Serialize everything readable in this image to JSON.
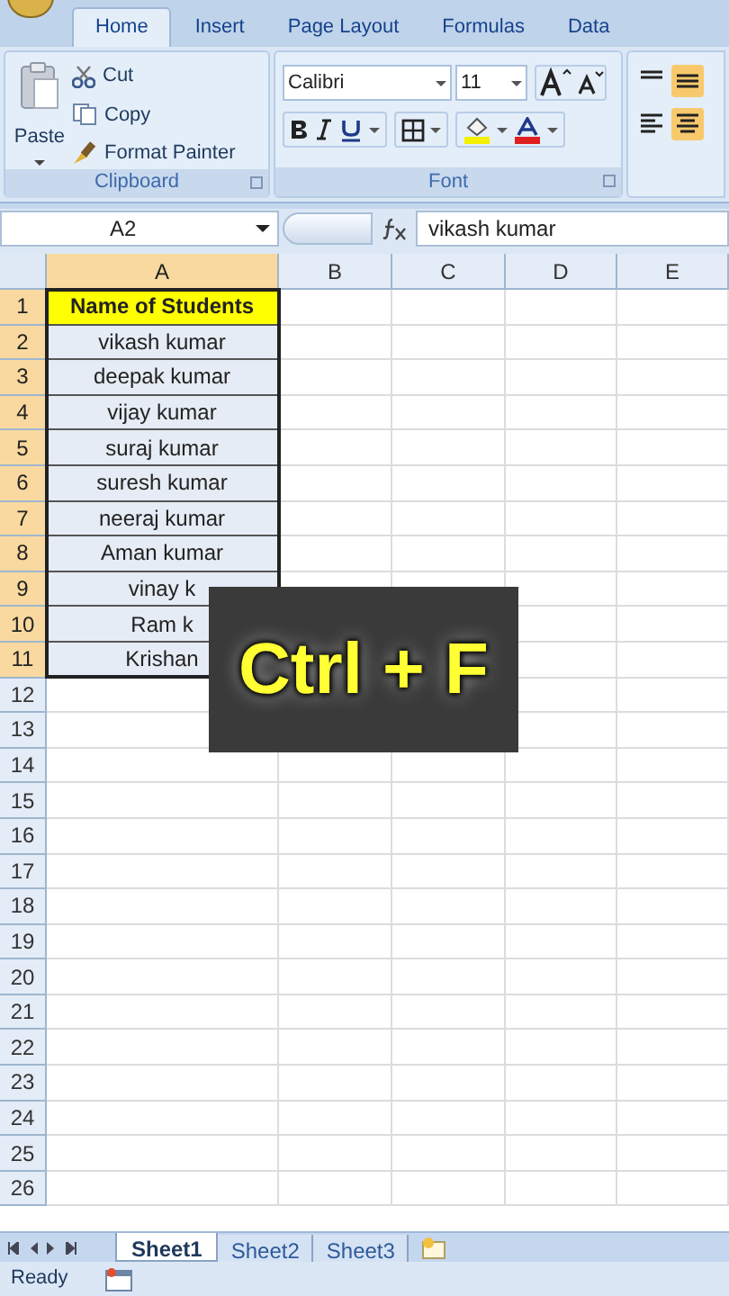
{
  "ribbon": {
    "tabs": [
      {
        "label": "Home",
        "selected": true
      },
      {
        "label": "Insert",
        "selected": false
      },
      {
        "label": "Page Layout",
        "selected": false
      },
      {
        "label": "Formulas",
        "selected": false
      },
      {
        "label": "Data",
        "selected": false
      }
    ],
    "clipboard": {
      "paste": "Paste",
      "cut": "Cut",
      "copy": "Copy",
      "format_painter": "Format Painter",
      "group_label": "Clipboard"
    },
    "font": {
      "font_name": "Calibri",
      "font_size": "11",
      "group_label": "Font"
    }
  },
  "formula_bar": {
    "name_box": "A2",
    "value": "vikash kumar"
  },
  "sheet": {
    "columns": [
      {
        "label": "A",
        "selected": true
      },
      {
        "label": "B",
        "selected": false
      },
      {
        "label": "C",
        "selected": false
      },
      {
        "label": "D",
        "selected": false
      },
      {
        "label": "E",
        "selected": false
      }
    ],
    "rows": [
      {
        "number": "1",
        "selected": true,
        "kind": "header",
        "a": "Name of Students"
      },
      {
        "number": "2",
        "selected": true,
        "kind": "data",
        "a": "vikash kumar"
      },
      {
        "number": "3",
        "selected": true,
        "kind": "data",
        "a": "deepak kumar"
      },
      {
        "number": "4",
        "selected": true,
        "kind": "data",
        "a": "vijay kumar"
      },
      {
        "number": "5",
        "selected": true,
        "kind": "data",
        "a": "suraj kumar"
      },
      {
        "number": "6",
        "selected": true,
        "kind": "data",
        "a": "suresh kumar"
      },
      {
        "number": "7",
        "selected": true,
        "kind": "data",
        "a": "neeraj kumar"
      },
      {
        "number": "8",
        "selected": true,
        "kind": "data",
        "a": "Aman kumar"
      },
      {
        "number": "9",
        "selected": true,
        "kind": "data",
        "a": "vinay k"
      },
      {
        "number": "10",
        "selected": true,
        "kind": "data",
        "a": "Ram k"
      },
      {
        "number": "11",
        "selected": true,
        "kind": "data",
        "a": "Krishan"
      },
      {
        "number": "12",
        "selected": false,
        "kind": "empty"
      },
      {
        "number": "13",
        "selected": false,
        "kind": "empty"
      },
      {
        "number": "14",
        "selected": false,
        "kind": "empty"
      },
      {
        "number": "15",
        "selected": false,
        "kind": "empty"
      },
      {
        "number": "16",
        "selected": false,
        "kind": "empty"
      },
      {
        "number": "17",
        "selected": false,
        "kind": "empty"
      },
      {
        "number": "18",
        "selected": false,
        "kind": "empty"
      },
      {
        "number": "19",
        "selected": false,
        "kind": "empty"
      },
      {
        "number": "20",
        "selected": false,
        "kind": "empty"
      },
      {
        "number": "21",
        "selected": false,
        "kind": "empty"
      },
      {
        "number": "22",
        "selected": false,
        "kind": "empty"
      },
      {
        "number": "23",
        "selected": false,
        "kind": "empty"
      },
      {
        "number": "24",
        "selected": false,
        "kind": "empty"
      },
      {
        "number": "25",
        "selected": false,
        "kind": "empty"
      },
      {
        "number": "26",
        "selected": false,
        "kind": "empty"
      }
    ]
  },
  "overlay": {
    "text": "Ctrl + F"
  },
  "sheet_tabs": [
    {
      "label": "Sheet1",
      "selected": true
    },
    {
      "label": "Sheet2",
      "selected": false
    },
    {
      "label": "Sheet3",
      "selected": false
    }
  ],
  "status_bar": {
    "text": "Ready"
  }
}
